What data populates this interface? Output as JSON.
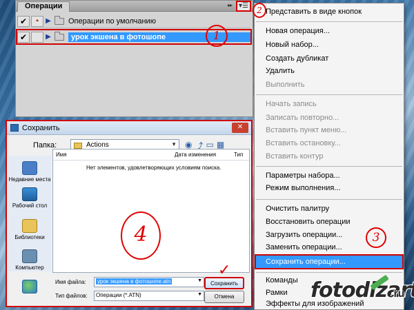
{
  "panel": {
    "tab_label": "Операции",
    "collapse_glyph": "▸▸",
    "menu_glyph": "▾☰",
    "rows": [
      {
        "label": "Операции по умолчанию",
        "checked": "✔",
        "dialog": "▪"
      },
      {
        "label": "урок экшена в фотошопе",
        "checked": "✔",
        "dialog": ""
      }
    ]
  },
  "annotations": {
    "a1": "1",
    "a2": "2",
    "a3": "3",
    "a4": "4",
    "check": "✓"
  },
  "dialog": {
    "title": "Сохранить",
    "close_glyph": "✕",
    "folder_label": "Папка:",
    "folder_value": "Actions",
    "places": [
      "Недавние места",
      "Рабочий стол",
      "Библиотеки",
      "Компьютер"
    ],
    "columns": {
      "name": "Имя",
      "date": "Дата изменения",
      "type": "Тип"
    },
    "empty_message": "Нет элементов, удовлетворяющих условиям поиска.",
    "filename_label": "Имя файла:",
    "filename_value": "урок экшена в фотошопе.atn",
    "filetype_label": "Тип файлов:",
    "filetype_value": "Операции (*.ATN)",
    "save_button": "Сохранить",
    "cancel_button": "Отмена"
  },
  "menu": {
    "items": [
      {
        "label": "Представить в виде кнопок",
        "enabled": true
      },
      {
        "label": "Новая операция...",
        "enabled": true
      },
      {
        "label": "Новый набор...",
        "enabled": true
      },
      {
        "label": "Создать дубликат",
        "enabled": true
      },
      {
        "label": "Удалить",
        "enabled": true
      },
      {
        "label": "Выполнить",
        "enabled": false
      },
      {
        "label": "Начать запись",
        "enabled": false
      },
      {
        "label": "Записать повторно...",
        "enabled": false
      },
      {
        "label": "Вставить пункт меню...",
        "enabled": false
      },
      {
        "label": "Вставить остановку...",
        "enabled": false
      },
      {
        "label": "Вставить контур",
        "enabled": false
      },
      {
        "label": "Параметры набора...",
        "enabled": true
      },
      {
        "label": "Режим выполнения...",
        "enabled": true
      },
      {
        "label": "Очистить палитру",
        "enabled": true
      },
      {
        "label": "Восстановить операции",
        "enabled": true
      },
      {
        "label": "Загрузить операции...",
        "enabled": true
      },
      {
        "label": "Заменить операции...",
        "enabled": true
      },
      {
        "label": "Сохранить операции...",
        "enabled": true,
        "highlighted": true
      },
      {
        "label": "Команды",
        "enabled": true
      },
      {
        "label": "Рамки",
        "enabled": true
      },
      {
        "label": "Эффекты для изображений",
        "enabled": true
      }
    ]
  },
  "watermark": {
    "text": "fotodizart",
    "tld": ".ru"
  },
  "colors": {
    "selection": "#3399ff",
    "annotation_red": "#e00000",
    "panel_bg": "#d4d4d4"
  }
}
